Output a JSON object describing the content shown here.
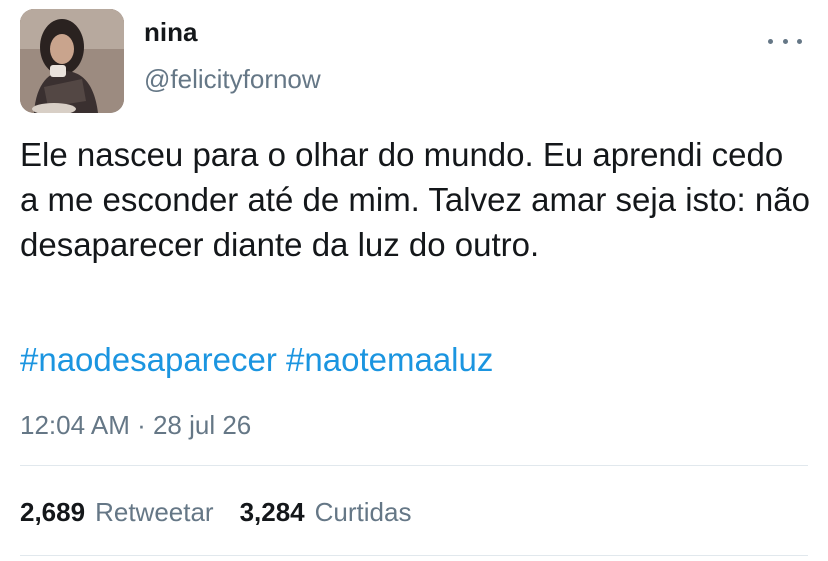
{
  "user": {
    "name": "nina",
    "handle": "@felicityfornow",
    "avatar": "profile-photo"
  },
  "tweet": {
    "text": "Ele nasceu para o olhar do mundo. Eu aprendi cedo a me esconder até de mim. Talvez amar seja isto: não desaparecer diante da luz do outro.",
    "hashtags": [
      "#naodesaparecer",
      "#naotemaaluz"
    ],
    "timestamp": "12:04 AM · 28 jul 26"
  },
  "stats": {
    "retweets_count": "2,689",
    "retweets_label": "Retweetar",
    "likes_count": "3,284",
    "likes_label": "Curtidas"
  },
  "menu": {
    "icon": "more-horizontal-icon"
  },
  "colors": {
    "text": "#14171a",
    "secondary": "#657786",
    "link": "#1b95e0",
    "divider": "#e1e8ed"
  }
}
